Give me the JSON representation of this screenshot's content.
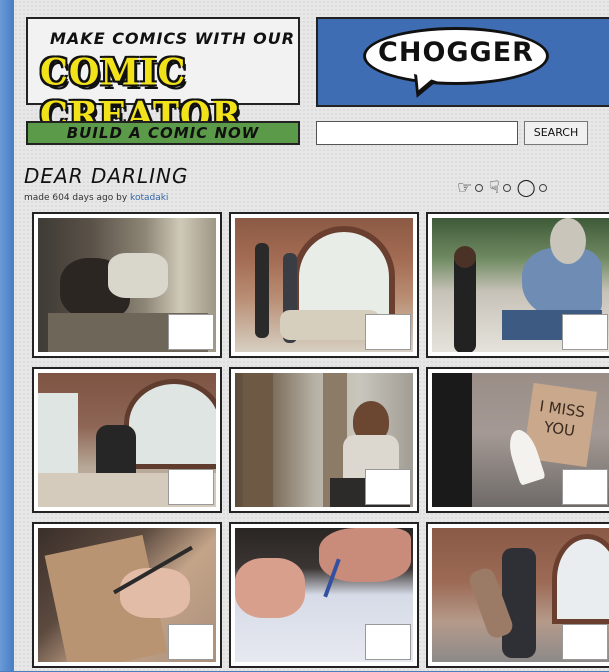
{
  "promo": {
    "line1": "MAKE COMICS WITH OUR",
    "line2": "COMIC CREATOR"
  },
  "logo": {
    "text": "CHOGGER"
  },
  "build_button": {
    "label": "BUILD A COMIC NOW"
  },
  "search": {
    "placeholder": "",
    "value": "",
    "button_label": "SEARCH"
  },
  "comic": {
    "title": "DEAR DARLING",
    "meta_prefix": "made 604 days ago by",
    "author": "kotadaki",
    "actions": [
      {
        "name": "like",
        "icon": "thumbs-up-icon"
      },
      {
        "name": "dislike",
        "icon": "thumbs-down-icon"
      },
      {
        "name": "comment",
        "icon": "comment-bubble-icon"
      }
    ],
    "panels": [
      {
        "id": 1,
        "scene": "man-kneeling-bedroom"
      },
      {
        "id": 2,
        "scene": "couple-arched-window"
      },
      {
        "id": 3,
        "scene": "woman-and-homeless-man"
      },
      {
        "id": 4,
        "scene": "man-sitting-on-bed"
      },
      {
        "id": 5,
        "scene": "woman-on-bench-palms"
      },
      {
        "id": 6,
        "scene": "i-miss-you-sign"
      },
      {
        "id": 7,
        "scene": "hand-writing-on-card"
      },
      {
        "id": 8,
        "scene": "hand-writing-on-paper"
      },
      {
        "id": 9,
        "scene": "man-spinning-woman"
      }
    ],
    "sign_text": "I MISS\nYOU"
  }
}
